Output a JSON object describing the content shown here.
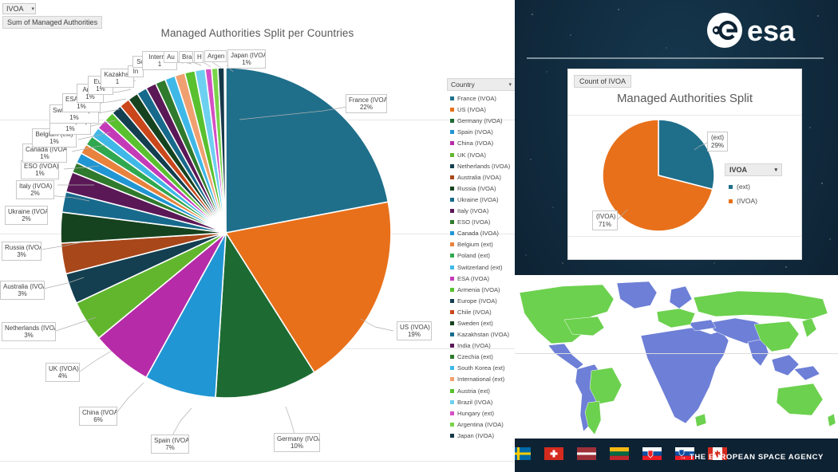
{
  "left_panel": {
    "slicer": {
      "label": "IVOA",
      "caret": "chevron-down-icon"
    },
    "field_button": "Sum of Managed Authorities",
    "chart_title": "Managed Authorities Split per Countries",
    "legend": {
      "header": "Country",
      "caret": "chevron-down-icon",
      "items": [
        {
          "label": "France (IVOA)",
          "color": "#1f6f8b"
        },
        {
          "label": "US (IVOA)",
          "color": "#e8701a"
        },
        {
          "label": "Germany (IVOA)",
          "color": "#1d6b32"
        },
        {
          "label": "Spain (IVOA)",
          "color": "#2196d4"
        },
        {
          "label": "China (IVOA)",
          "color": "#b62ba8"
        },
        {
          "label": "UK (IVOA)",
          "color": "#62b62e"
        },
        {
          "label": "Netherlands (IVOA)",
          "color": "#133f50"
        },
        {
          "label": "Australia (IVOA)",
          "color": "#a8471a"
        },
        {
          "label": "Russia (IVOA)",
          "color": "#16431f"
        },
        {
          "label": "Ukraine (IVOA)",
          "color": "#176a8c"
        },
        {
          "label": "Italy (IVOA)",
          "color": "#5b1857"
        },
        {
          "label": "ESO (IVOA)",
          "color": "#2f7a2d"
        },
        {
          "label": "Canada (IVOA)",
          "color": "#2196d4"
        },
        {
          "label": "Belgium (ext)",
          "color": "#e8823c"
        },
        {
          "label": "Poland (ext)",
          "color": "#2fa84f"
        },
        {
          "label": "Switzerland (ext)",
          "color": "#3fb8e8"
        },
        {
          "label": "ESA (IVOA)",
          "color": "#c43bb8"
        },
        {
          "label": "Armenia (IVOA)",
          "color": "#59c02f"
        },
        {
          "label": "Europe (IVOA)",
          "color": "#133f50"
        },
        {
          "label": "Chile (IVOA)",
          "color": "#c9471a"
        },
        {
          "label": "Sweden (ext)",
          "color": "#16431f"
        },
        {
          "label": "Kazakhstan (IVOA)",
          "color": "#176a8c"
        },
        {
          "label": "India (IVOA)",
          "color": "#5b1857"
        },
        {
          "label": "Czechia (ext)",
          "color": "#2f7a2d"
        },
        {
          "label": "South Korea (ext)",
          "color": "#3fb8e8"
        },
        {
          "label": "International (ext)",
          "color": "#f0a070"
        },
        {
          "label": "Austria (ext)",
          "color": "#59c02f"
        },
        {
          "label": "Brazil (IVOA)",
          "color": "#6ed0f0"
        },
        {
          "label": "Hungary (ext)",
          "color": "#d44fc4"
        },
        {
          "label": "Argentina (IVOA)",
          "color": "#79d44a"
        },
        {
          "label": "Japan (IVOA)",
          "color": "#16394a"
        }
      ]
    },
    "callouts": [
      {
        "name": "france",
        "label": "France (IVOA)",
        "pct": "22%"
      },
      {
        "name": "us",
        "label": "US (IVOA)",
        "pct": "19%"
      },
      {
        "name": "germany",
        "label": "Germany (IVOA)",
        "pct": "10%"
      },
      {
        "name": "spain",
        "label": "Spain (IVOA)",
        "pct": "7%"
      },
      {
        "name": "china",
        "label": "China (IVOA)",
        "pct": "6%"
      },
      {
        "name": "uk",
        "label": "UK (IVOA)",
        "pct": "4%"
      },
      {
        "name": "netherlands",
        "label": "Netherlands (IVOA)",
        "pct": "3%"
      },
      {
        "name": "australia",
        "label": "Australia (IVOA)",
        "pct": "3%"
      },
      {
        "name": "russia",
        "label": "Russia (IVOA)",
        "pct": "3%"
      },
      {
        "name": "ukraine",
        "label": "Ukraine (IVOA)",
        "pct": "2%"
      },
      {
        "name": "italy",
        "label": "Italy (IVOA)",
        "pct": "2%"
      },
      {
        "name": "eso",
        "label": "ESO (IVOA)",
        "pct": "1%"
      },
      {
        "name": "canada",
        "label": "Canada (IVOA)",
        "pct": "1%"
      },
      {
        "name": "belgium",
        "label": "Belgium (ext)",
        "pct": "1%"
      },
      {
        "name": "poland",
        "label": "Poland (ext)",
        "pct": "1%"
      },
      {
        "name": "switzerland",
        "label": "Switzerland (ext)",
        "pct": "1%"
      },
      {
        "name": "esa",
        "label": "ESA (IVOA)",
        "pct": "1%"
      },
      {
        "name": "armenia",
        "label": "Arme",
        "pct": "1%"
      },
      {
        "name": "europe",
        "label": "Euro",
        "pct": "1%"
      },
      {
        "name": "chile",
        "label": "",
        "pct": "1%"
      },
      {
        "name": "kazakhstan",
        "label": "Kazakhst",
        "pct": "1"
      },
      {
        "name": "india",
        "label": "In",
        "pct": ""
      },
      {
        "name": "southkorea",
        "label": "So",
        "pct": ""
      },
      {
        "name": "international",
        "label": "Internat",
        "pct": "1"
      },
      {
        "name": "austria",
        "label": "Au",
        "pct": ""
      },
      {
        "name": "brazil",
        "label": "Bra",
        "pct": ""
      },
      {
        "name": "hungary",
        "label": "H",
        "pct": ""
      },
      {
        "name": "argentina",
        "label": "Argen",
        "pct": ""
      },
      {
        "name": "japan",
        "label": "Japan (IVOA)",
        "pct": "1%"
      }
    ]
  },
  "right_panel": {
    "logo_text": "esa",
    "card": {
      "field_button": "Count of IVOA",
      "title": "Managed Authorities Split",
      "callout_ext": {
        "label": "(ext)",
        "pct": "29%"
      },
      "callout_ivoa": {
        "label": "(IVOA)",
        "pct": "71%"
      },
      "legend": {
        "header": "IVOA",
        "caret": "chevron-down-icon",
        "items": [
          {
            "label": "(ext)",
            "color": "#1f6f8b"
          },
          {
            "label": "(IVOA)",
            "color": "#e8701a"
          }
        ]
      }
    },
    "map": {
      "color_member": "#6cd14e",
      "color_other": "#6d7fd6"
    },
    "footer": {
      "arrow": "→",
      "text": "THE EUROPEAN SPACE AGENCY",
      "flags": [
        "sweden-flag",
        "switzerland-flag",
        "latvia-flag",
        "lithuania-flag",
        "slovakia-flag",
        "slovenia-flag",
        "canada-flag"
      ]
    }
  },
  "chart_data": [
    {
      "type": "pie",
      "title": "Managed Authorities Split per Countries",
      "categories": [
        "France (IVOA)",
        "US (IVOA)",
        "Germany (IVOA)",
        "Spain (IVOA)",
        "China (IVOA)",
        "UK (IVOA)",
        "Netherlands (IVOA)",
        "Australia (IVOA)",
        "Russia (IVOA)",
        "Ukraine (IVOA)",
        "Italy (IVOA)",
        "ESO (IVOA)",
        "Canada (IVOA)",
        "Belgium (ext)",
        "Poland (ext)",
        "Switzerland (ext)",
        "ESA (IVOA)",
        "Armenia (IVOA)",
        "Europe (IVOA)",
        "Chile (IVOA)",
        "Sweden (ext)",
        "Kazakhstan (IVOA)",
        "India (IVOA)",
        "Czechia (ext)",
        "South Korea (ext)",
        "International (ext)",
        "Austria (ext)",
        "Brazil (IVOA)",
        "Hungary (ext)",
        "Argentina (IVOA)",
        "Japan (IVOA)"
      ],
      "values": [
        22,
        19,
        10,
        7,
        6,
        4,
        3,
        3,
        3,
        2,
        2,
        1,
        1,
        1,
        1,
        1,
        1,
        1,
        1,
        1,
        1,
        1,
        1,
        1,
        1,
        1,
        1,
        1,
        1,
        1,
        1
      ],
      "unit": "%",
      "colors": [
        "#1f6f8b",
        "#e8701a",
        "#1d6b32",
        "#2196d4",
        "#b62ba8",
        "#62b62e",
        "#133f50",
        "#a8471a",
        "#16431f",
        "#176a8c",
        "#5b1857",
        "#2f7a2d",
        "#2196d4",
        "#e8823c",
        "#2fa84f",
        "#3fb8e8",
        "#c43bb8",
        "#59c02f",
        "#133f50",
        "#c9471a",
        "#16431f",
        "#176a8c",
        "#5b1857",
        "#2f7a2d",
        "#3fb8e8",
        "#f0a070",
        "#59c02f",
        "#6ed0f0",
        "#d44fc4",
        "#79d44a",
        "#16394a"
      ],
      "legend_position": "right",
      "legend_title": "Country"
    },
    {
      "type": "pie",
      "title": "Managed Authorities Split",
      "categories": [
        "(ext)",
        "(IVOA)"
      ],
      "values": [
        29,
        71
      ],
      "unit": "%",
      "colors": [
        "#1f6f8b",
        "#e8701a"
      ],
      "legend_position": "right",
      "legend_title": "IVOA"
    }
  ]
}
